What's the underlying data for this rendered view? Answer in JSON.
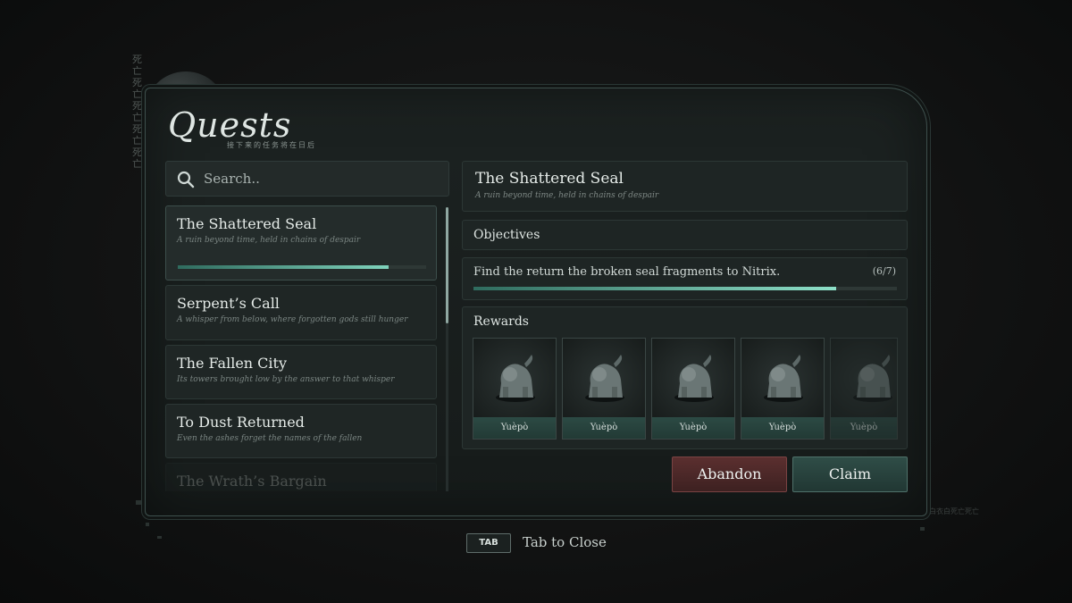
{
  "header": {
    "title": "Quests",
    "subtitle": "接下来的任务将在日后",
    "side_glyphs": "死亡死亡死亡死亡死亡",
    "corner_glyphs": "白衣白死亡死亡"
  },
  "search": {
    "placeholder": "Search..",
    "icon": "search-icon"
  },
  "quests": [
    {
      "name": "The Shattered Seal",
      "description": "A ruin beyond time, held in chains of despair",
      "progress": 0.85,
      "active": true
    },
    {
      "name": "Serpent’s Call",
      "description": "A whisper from below, where forgotten gods still hunger"
    },
    {
      "name": "The Fallen City",
      "description": "Its towers brought low by the answer to that whisper"
    },
    {
      "name": "To Dust Returned",
      "description": "Even the ashes forget the names of the fallen"
    },
    {
      "name": "The Wrath’s Bargain",
      "description": ""
    }
  ],
  "detail": {
    "title": "The Shattered Seal",
    "description": "A ruin beyond time, held in chains of despair",
    "objectives_label": "Objectives",
    "objective": {
      "text": "Find the return the broken seal fragments to Nitrix.",
      "count": "(6/7)",
      "progress": 0.857
    },
    "rewards_label": "Rewards",
    "rewards": [
      {
        "name": "Yuèpò"
      },
      {
        "name": "Yuèpò"
      },
      {
        "name": "Yuèpò"
      },
      {
        "name": "Yuèpò"
      },
      {
        "name": "Yuèpò"
      }
    ]
  },
  "actions": {
    "abandon": "Abandon",
    "claim": "Claim"
  },
  "footer": {
    "key": "TAB",
    "hint": "Tab to Close"
  },
  "colors": {
    "accent": "#7fd3bc",
    "abandon": "#5b2f2f",
    "claim": "#2f4d47"
  }
}
